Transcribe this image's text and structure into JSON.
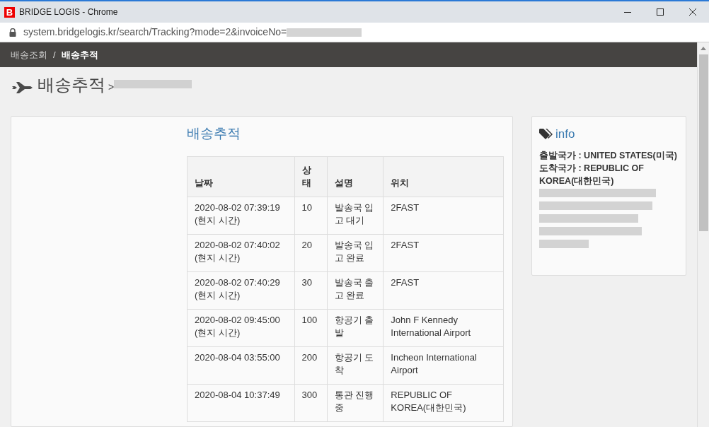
{
  "window": {
    "title": "BRIDGE LOGIS - Chrome",
    "logo": "B"
  },
  "address_bar": {
    "url": "system.bridgelogis.kr/search/Tracking?mode=2&invoiceNo="
  },
  "breadcrumb": [
    {
      "label": "배송조회",
      "selected": false
    },
    {
      "label": "배송추적",
      "selected": true
    }
  ],
  "breadcrumb_separator": "/",
  "page_heading": {
    "title": "배송추적",
    "separator": ">"
  },
  "tracking": {
    "title": "배송추적",
    "columns": [
      "날짜",
      "상태",
      "설명",
      "위치"
    ],
    "rows": [
      {
        "date": "2020-08-02 07:39:19 (현지 시간)",
        "status": "10",
        "description": "발송국 입고 대기",
        "location": "2FAST"
      },
      {
        "date": "2020-08-02 07:40:02 (현지 시간)",
        "status": "20",
        "description": "발송국 입고 완료",
        "location": "2FAST"
      },
      {
        "date": "2020-08-02 07:40:29 (현지 시간)",
        "status": "30",
        "description": "발송국 출고 완료",
        "location": "2FAST"
      },
      {
        "date": "2020-08-02 09:45:00 (현지 시간)",
        "status": "100",
        "description": "항공기 출발",
        "location": "John F Kennedy International Airport"
      },
      {
        "date": "2020-08-04 03:55:00",
        "status": "200",
        "description": "항공기 도착",
        "location": "Incheon International Airport"
      },
      {
        "date": "2020-08-04 10:37:49",
        "status": "300",
        "description": "통관 진행중",
        "location": "REPUBLIC OF KOREA(대한민국)"
      }
    ]
  },
  "info": {
    "title": "info",
    "lines": [
      "출발국가 : UNITED STATES(미국)",
      "도착국가 : REPUBLIC OF KOREA(대한민국)"
    ]
  }
}
